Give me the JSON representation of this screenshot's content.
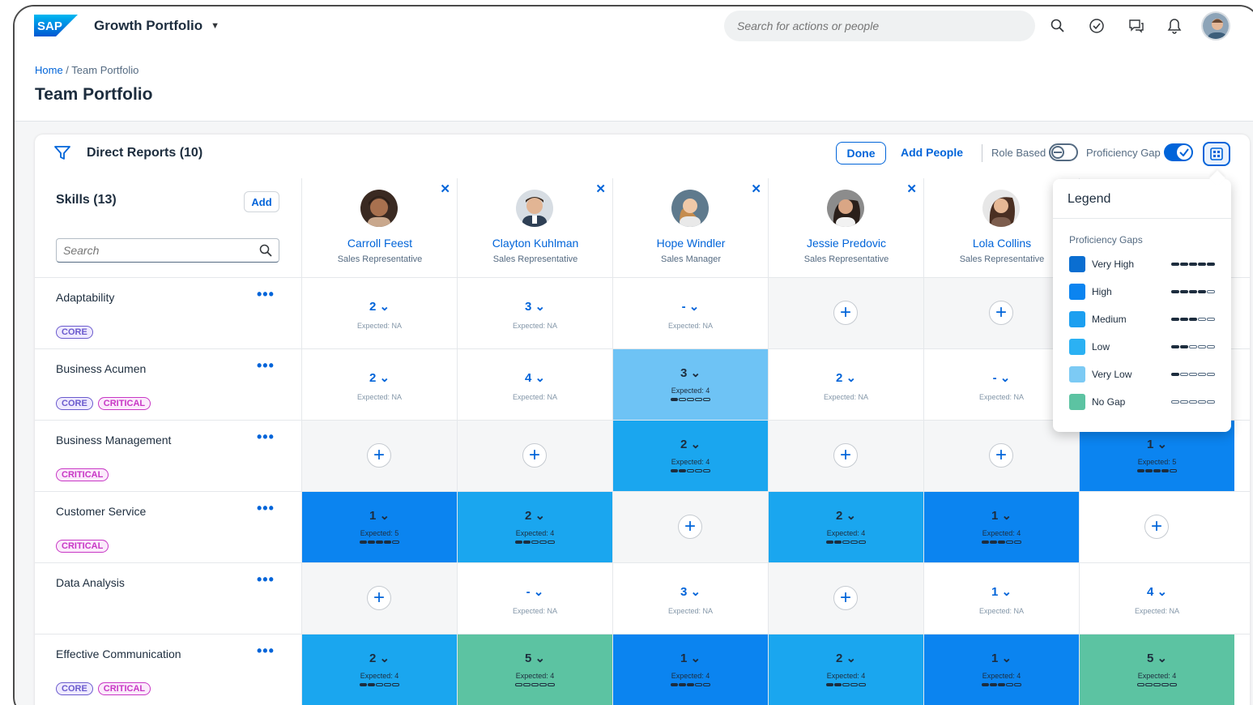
{
  "shell": {
    "product_title": "Growth Portfolio",
    "search_placeholder": "Search for actions or people",
    "logo_text": "SAP"
  },
  "breadcrumb": {
    "home": "Home",
    "sep": " / ",
    "current": "Team Portfolio"
  },
  "page_title": "Team Portfolio",
  "toolbar": {
    "title": "Direct Reports (10)",
    "done": "Done",
    "add_people": "Add People",
    "role_based": "Role Based",
    "proficiency_gap": "Proficiency Gap"
  },
  "skills_panel": {
    "title": "Skills (13)",
    "add": "Add",
    "search_placeholder": "Search"
  },
  "people": [
    {
      "name": "Carroll Feest",
      "role": "Sales Representative"
    },
    {
      "name": "Clayton Kuhlman",
      "role": "Sales Representative"
    },
    {
      "name": "Hope Windler",
      "role": "Sales Manager"
    },
    {
      "name": "Jessie Predovic",
      "role": "Sales Representative"
    },
    {
      "name": "Lola Collins",
      "role": "Sales Representative"
    }
  ],
  "tags": {
    "core": "CORE",
    "critical": "CRITICAL"
  },
  "skills": [
    {
      "name": "Adaptability"
    },
    {
      "name": "Business Acumen"
    },
    {
      "name": "Business Management"
    },
    {
      "name": "Customer Service"
    },
    {
      "name": "Data Analysis"
    },
    {
      "name": "Effective Communication"
    }
  ],
  "cells": [
    [
      {
        "v": "2",
        "e": "Expected: NA"
      },
      {
        "v": "3",
        "e": "Expected: NA"
      },
      {
        "v": "-",
        "e": "Expected: NA"
      },
      {
        "v": "+"
      },
      {
        "v": "+"
      },
      {
        "v": ""
      }
    ],
    [
      {
        "v": "2",
        "e": "Expected: NA"
      },
      {
        "v": "4",
        "e": "Expected: NA"
      },
      {
        "v": "3",
        "e": "Expected: 4"
      },
      {
        "v": "2",
        "e": "Expected: NA"
      },
      {
        "v": "-",
        "e": "Expected: NA"
      },
      {
        "v": ""
      }
    ],
    [
      {
        "v": "+"
      },
      {
        "v": "+"
      },
      {
        "v": "2",
        "e": "Expected: 4"
      },
      {
        "v": "+"
      },
      {
        "v": "+"
      },
      {
        "v": "1",
        "e": "Expected: 5"
      }
    ],
    [
      {
        "v": "1",
        "e": "Expected: 5"
      },
      {
        "v": "2",
        "e": "Expected: 4"
      },
      {
        "v": "+"
      },
      {
        "v": "2",
        "e": "Expected: 4"
      },
      {
        "v": "1",
        "e": "Expected: 4"
      },
      {
        "v": "+"
      }
    ],
    [
      {
        "v": "+"
      },
      {
        "v": "-",
        "e": "Expected: NA"
      },
      {
        "v": "3",
        "e": "Expected: NA"
      },
      {
        "v": "+"
      },
      {
        "v": "1",
        "e": "Expected: NA"
      },
      {
        "v": "4",
        "e": "Expected: NA"
      }
    ],
    [
      {
        "v": "2",
        "e": "Expected: 4"
      },
      {
        "v": "5",
        "e": "Expected: 4"
      },
      {
        "v": "1",
        "e": "Expected: 4"
      },
      {
        "v": "2",
        "e": "Expected: 4"
      },
      {
        "v": "1",
        "e": "Expected: 4"
      },
      {
        "v": "5",
        "e": "Expected: 4"
      }
    ]
  ],
  "legend": {
    "title": "Legend",
    "subtitle": "Proficiency Gaps",
    "items": [
      {
        "label": "Very High",
        "color": "#0a6ed1"
      },
      {
        "label": "High",
        "color": "#0b84f0"
      },
      {
        "label": "Medium",
        "color": "#1c9ff0"
      },
      {
        "label": "Low",
        "color": "#2bb1f3"
      },
      {
        "label": "Very Low",
        "color": "#7ccaf4"
      },
      {
        "label": "No Gap",
        "color": "#5cc3a2"
      }
    ]
  },
  "colors": {
    "accent": "#0064d9",
    "core": "#6a5acd",
    "critical": "#c837c5"
  }
}
